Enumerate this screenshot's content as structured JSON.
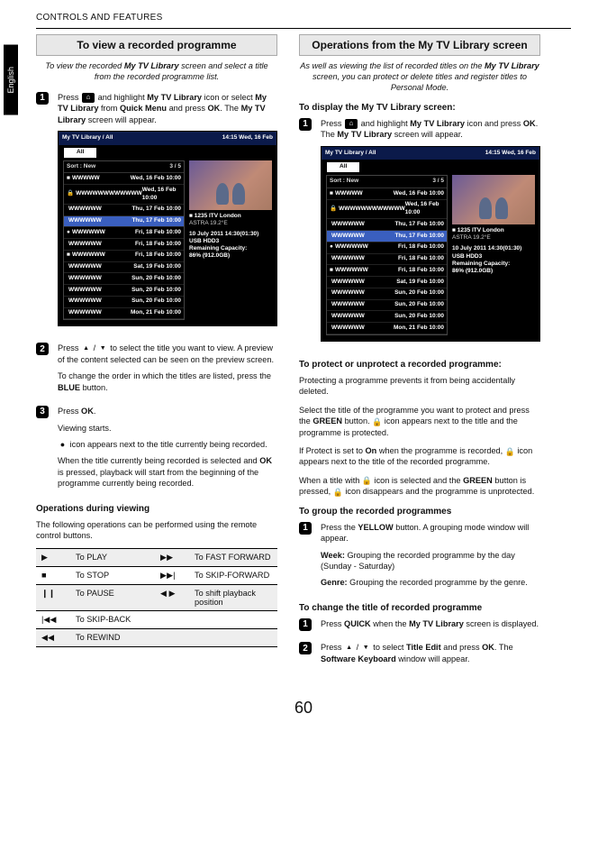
{
  "running_head": "CONTROLS AND FEATURES",
  "side_tab": "English",
  "page_number": "60",
  "left": {
    "section_title": "To view a recorded programme",
    "intro_pre": "To view the recorded ",
    "intro_bold": "My TV Library",
    "intro_post": " screen and select a title from the recorded programme list.",
    "step1": {
      "t1": "Press ",
      "t2": " and highlight ",
      "b1": "My TV Library",
      "t3": " icon or select ",
      "b2": "My TV Library",
      "t4": " from ",
      "b3": "Quick Menu",
      "t5": " and press ",
      "b4": "OK",
      "t6": ". The ",
      "b5": "My TV Library",
      "t7": " screen will appear."
    },
    "step2": {
      "t1": "Press ",
      "t2": " / ",
      "t3": " to select the title you want to view. A preview of the content selected can be seen on the preview screen.",
      "p2a": "To change the order in which the titles are listed, press the ",
      "p2b": "BLUE",
      "p2c": " button."
    },
    "step3": {
      "t1": "Press ",
      "b1": "OK",
      "t2": ".",
      "p2": "Viewing starts.",
      "p3": " icon appears next to the title currently being recorded.",
      "p4a": "When the title currently being recorded is selected and ",
      "p4b": "OK",
      "p4c": " is pressed, playback will start from the beginning of the programme currently being recorded."
    },
    "ops_head": "Operations during viewing",
    "ops_intro": "The following operations can be performed using the remote control buttons.",
    "remote": {
      "r1": {
        "g1": "▶",
        "l1": "To PLAY",
        "g2": "▶▶",
        "l2": "To FAST FORWARD"
      },
      "r2": {
        "g1": "■",
        "l1": "To STOP",
        "g2": "▶▶|",
        "l2": "To SKIP-FORWARD"
      },
      "r3": {
        "g1": "❙❙",
        "l1": "To PAUSE",
        "g2": "◀ ▶",
        "l2": "To shift playback position"
      },
      "r4": {
        "g1": "|◀◀",
        "l1": "To SKIP-BACK",
        "g2": "",
        "l2": ""
      },
      "r5": {
        "g1": "◀◀",
        "l1": "To REWIND",
        "g2": "",
        "l2": ""
      }
    }
  },
  "right": {
    "section_title": "Operations from the My TV Library screen",
    "intro_pre": "As well as viewing the list of recorded titles on the ",
    "intro_b1": "My TV Library",
    "intro_post": " screen, you can protect or delete titles and register titles to Personal Mode.",
    "display_head": "To display the My TV Library screen:",
    "step1": {
      "t1": "Press ",
      "t2": " and highlight ",
      "b1": "My TV Library",
      "t3": " icon and press ",
      "b2": "OK",
      "t4": ". The ",
      "b3": "My TV Library",
      "t5": " screen will appear."
    },
    "protect_head": "To protect or unprotect a recorded programme:",
    "protect_p1": "Protecting a programme prevents it from being accidentally deleted.",
    "protect_p2": {
      "t1": "Select the title of the programme you want to protect and press the ",
      "b1": "GREEN",
      "t2": " button. ",
      "t3": " icon appears next to the title and the programme is protected."
    },
    "protect_p3": {
      "t1": "If Protect is set to ",
      "b1": "On",
      "t2": " when the programme is recorded, ",
      "t3": " icon appears next to the title of the recorded programme."
    },
    "protect_p4": {
      "t1": "When a title with ",
      "t2": " icon is selected and the ",
      "b1": "GREEN",
      "t3": " button is pressed, ",
      "t4": " icon disappears and the programme is unprotected."
    },
    "group_head": "To group the recorded programmes",
    "group_step1": {
      "t1": "Press the ",
      "b1": "YELLOW",
      "t2": " button. A grouping mode window will appear.",
      "wk_b": "Week:",
      "wk_t": " Grouping the recorded programme by the day (Sunday - Saturday)",
      "gn_b": "Genre:",
      "gn_t": " Grouping the recorded programme by the genre."
    },
    "change_head": "To change the title of recorded programme",
    "change_s1": {
      "t1": "Press ",
      "b1": "QUICK",
      "t2": " when the ",
      "b2": "My TV Library",
      "t3": " screen is displayed."
    },
    "change_s2": {
      "t1": "Press ",
      "t2": " / ",
      "t3": " to select ",
      "b1": "Title Edit",
      "t4": " and press ",
      "b2": "OK",
      "t5": ". The ",
      "b3": "Software Keyboard",
      "t6": " window will appear."
    }
  },
  "tvshot": {
    "head_left": "My TV Library / All",
    "head_right": "14:15 Wed, 16 Feb",
    "tab": "All",
    "sort_l": "Sort : New",
    "sort_r": "3 / 5",
    "rows": [
      {
        "icon": "■",
        "title": "WWWWW",
        "time": "Wed, 16 Feb 10:00",
        "hl": false
      },
      {
        "icon": "🔒",
        "title": "WWWWWWWWWWWW",
        "time": "Wed, 16 Feb 10:00",
        "hl": false
      },
      {
        "icon": "",
        "title": "WWWWWW",
        "time": "Thu, 17 Feb 10:00",
        "hl": false
      },
      {
        "icon": "",
        "title": "WWWWWW",
        "time": "Thu, 17 Feb 10:00",
        "hl": true
      },
      {
        "icon": "●",
        "title": "WWWWWW",
        "time": "Fri, 18 Feb 10:00",
        "hl": false
      },
      {
        "icon": "",
        "title": "WWWWWW",
        "time": "Fri, 18 Feb 10:00",
        "hl": false
      },
      {
        "icon": "■",
        "title": "WWWWWW",
        "time": "Fri, 18 Feb 10:00",
        "hl": false
      },
      {
        "icon": "",
        "title": "WWWWWW",
        "time": "Sat, 19 Feb 10:00",
        "hl": false
      },
      {
        "icon": "",
        "title": "WWWWWW",
        "time": "Sun, 20 Feb 10:00",
        "hl": false
      },
      {
        "icon": "",
        "title": "WWWWWW",
        "time": "Sun, 20 Feb 10:00",
        "hl": false
      },
      {
        "icon": "",
        "title": "WWWWWW",
        "time": "Sun, 20 Feb 10:00",
        "hl": false
      },
      {
        "icon": "",
        "title": "WWWWWW",
        "time": "Mon, 21 Feb 10:00",
        "hl": false
      }
    ],
    "side": {
      "channel": "1235 ITV London",
      "sat": "ASTRA 19.2°E",
      "date": "10 July 2011  14:30(01:30)",
      "usb": "USB HDD3",
      "remain_l": "Remaining Capacity:",
      "remain_v": "86% (912.0GB)"
    }
  }
}
